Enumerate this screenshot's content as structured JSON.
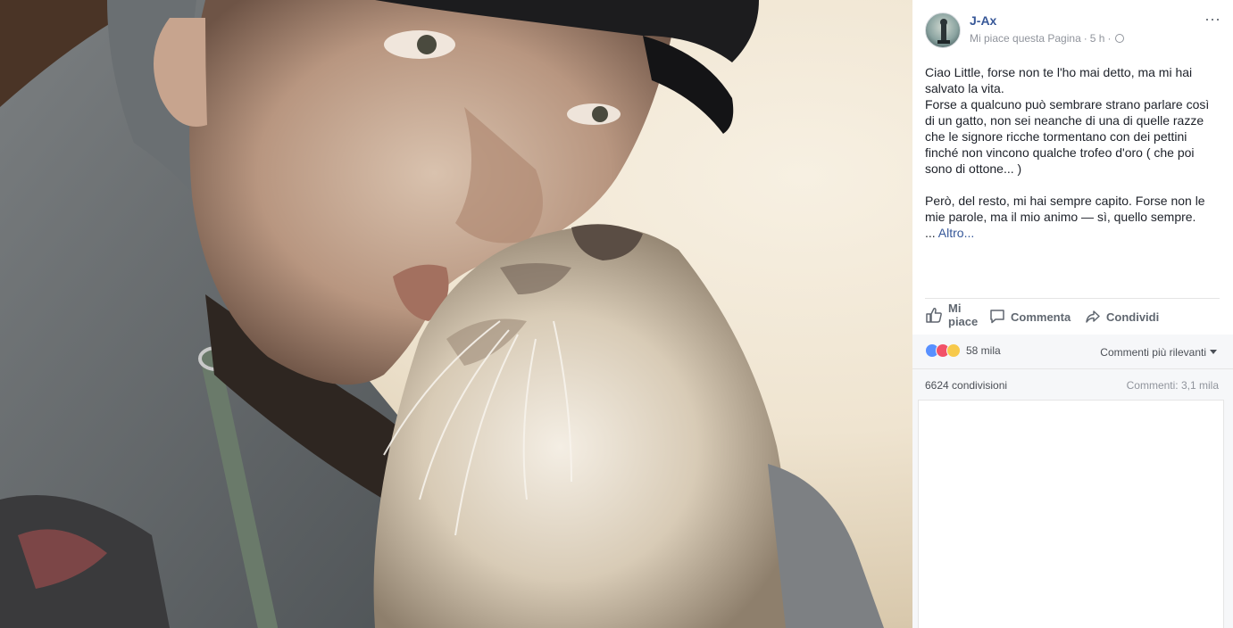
{
  "photo": {
    "description_icon": "photo-selfie-with-cat"
  },
  "post": {
    "page_name": "J-Ax",
    "like_page": "Mi piace questa Pagina",
    "time": "5 h",
    "paragraph1": "Ciao Little, forse non te l'ho mai detto, ma mi hai salvato la vita.",
    "paragraph2": "Forse a qualcuno può sembrare strano parlare così di un gatto, non sei neanche di una di quelle razze che le signore ricche tormentano con dei pettini finché non vincono qualche trofeo d'oro ( che poi sono di ottone... )",
    "paragraph3": "Però, del resto, mi hai sempre capito. Forse non le mie parole, ma il mio animo — sì, quello sempre.",
    "ellipsis": "... ",
    "more_label": "Altro..."
  },
  "actions": {
    "like_line1": "Mi",
    "like_line2": "piace",
    "comment": "Commenta",
    "share": "Condividi"
  },
  "stats": {
    "reactions_count": "58 mila",
    "sort_label": "Commenti più rilevanti",
    "shares": "6624 condivisioni",
    "comments": "Commenti: 3,1 mila"
  },
  "colors": {
    "link": "#385898",
    "secondary_text": "#90949c",
    "like_reaction": "#5890ff",
    "love_reaction": "#f25268",
    "sad_reaction": "#f7c94b"
  }
}
